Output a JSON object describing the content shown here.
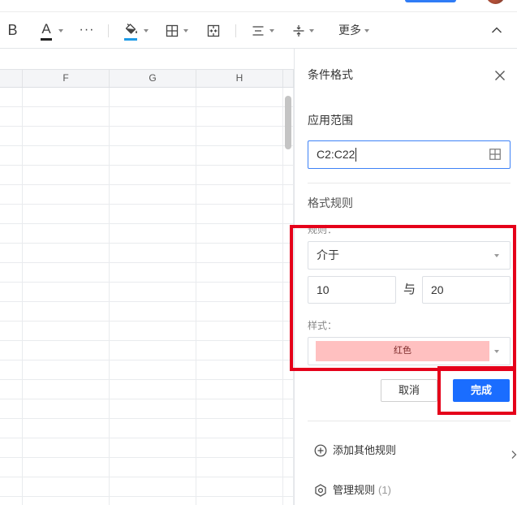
{
  "toolbar": {
    "bold_label": "B",
    "font_color_label": "A",
    "overflow_label": "···",
    "more_label": "更多",
    "icons": {
      "fill_color": "paint-bucket-icon",
      "borders": "borders-icon",
      "merge_cells": "merge-cells-icon",
      "horizontal_align": "align-center-icon",
      "vertical_align": "vertical-align-icon",
      "collapse": "chevron-up-icon",
      "dropdown": "caret-down-icon"
    }
  },
  "sheet": {
    "columns": [
      "F",
      "G",
      "H"
    ]
  },
  "panel": {
    "title": "条件格式",
    "range": {
      "label": "应用范围",
      "value": "C2:C22"
    },
    "rules_section_label": "格式规则",
    "rule": {
      "label": "规则：",
      "condition": "介于",
      "min": "10",
      "and_label": "与",
      "max": "20"
    },
    "style": {
      "label": "样式：",
      "value": "红色"
    },
    "buttons": {
      "cancel": "取消",
      "done": "完成"
    },
    "add_rule_label": "添加其他规则",
    "manage_rules_label": "管理规则",
    "manage_rules_count": "(1)",
    "icons": {
      "close": "close-icon",
      "range_picker": "grid-icon",
      "add_rule": "plus-circle-icon",
      "manage_rules": "hexagon-settings-icon",
      "expand": "chevron-right-icon"
    }
  },
  "colors": {
    "accent": "#1a6dff",
    "annotation_red": "#e5001a",
    "fill_color_underline": "#1d9be6",
    "font_color_underline": "#222222",
    "style_swatch": "#ffc0c0",
    "style_swatch_text": "#7d2b2b",
    "input_focus_border": "#3e82f7",
    "share_button": "#2f7cf6"
  }
}
